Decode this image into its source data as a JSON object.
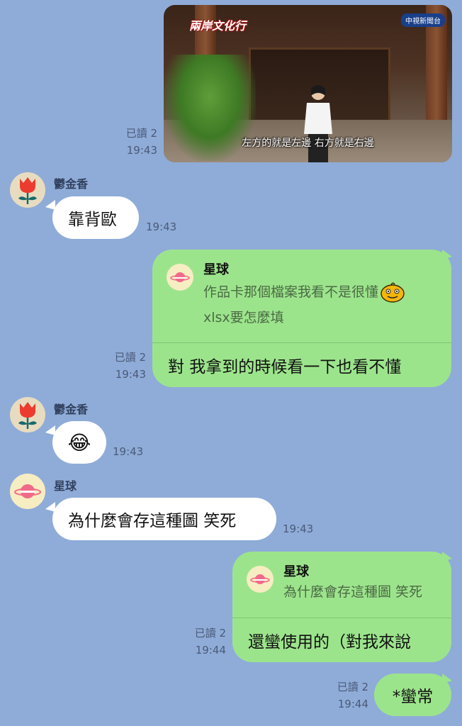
{
  "messages": {
    "video": {
      "logo_text": "兩岸文化行",
      "channel_text": "中視新聞台",
      "caption": "左方的就是左邊 右方就是右邊",
      "read": "已讀 2",
      "time": "19:43"
    },
    "m1": {
      "sender": "鬱金香",
      "text": "靠背歐",
      "time": "19:43"
    },
    "m2": {
      "quote_name": "星球",
      "quote_line1": "作品卡那個檔案我看不是很懂",
      "quote_line2": "xlsx要怎麼填",
      "text": "對 我拿到的時候看一下也看不懂",
      "read": "已讀 2",
      "time": "19:43"
    },
    "m3": {
      "sender": "鬱金香",
      "emoji": "😂",
      "time": "19:43"
    },
    "m4": {
      "sender": "星球",
      "text": "為什麼會存這種圖 笑死",
      "time": "19:43"
    },
    "m5": {
      "quote_name": "星球",
      "quote_line1": "為什麼會存這種圖 笑死",
      "text": "還蠻使用的（對我來說",
      "read": "已讀 2",
      "time": "19:44"
    },
    "m6": {
      "text": "*蠻常",
      "read": "已讀 2",
      "time": "19:44"
    }
  },
  "colors": {
    "background": "#8facd8",
    "outgoing_bubble": "#9ce48c",
    "incoming_bubble": "#ffffff"
  },
  "icons": {
    "tulip_avatar": "tulip-icon",
    "planet_avatar": "planet-icon",
    "sticker": "orange-face-icon"
  }
}
